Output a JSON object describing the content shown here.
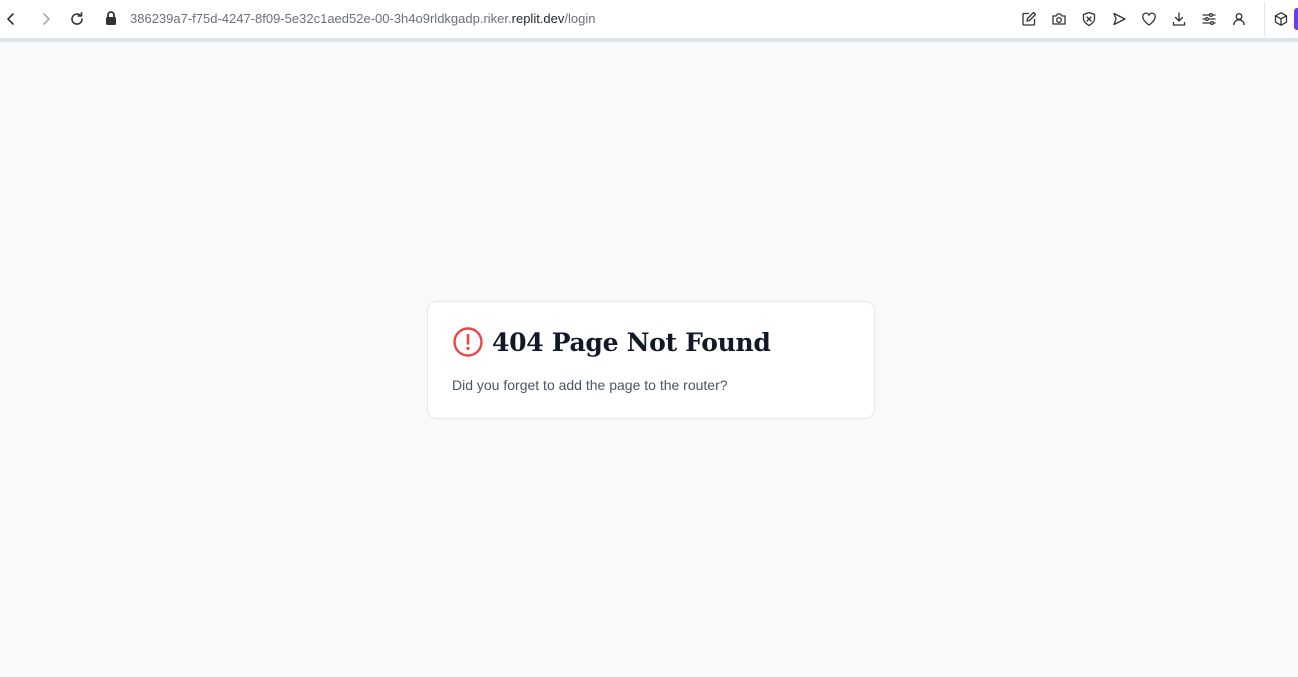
{
  "browser": {
    "url_prefix": "386239a7-f75d-4247-8f09-5e32c1aed52e-00-3h4o9rldkgadp.riker.",
    "url_host": "replit.dev",
    "url_path": "/login"
  },
  "error_card": {
    "title": "404 Page Not Found",
    "message": "Did you forget to add the page to the router?",
    "icon_color": "#ef4444"
  }
}
